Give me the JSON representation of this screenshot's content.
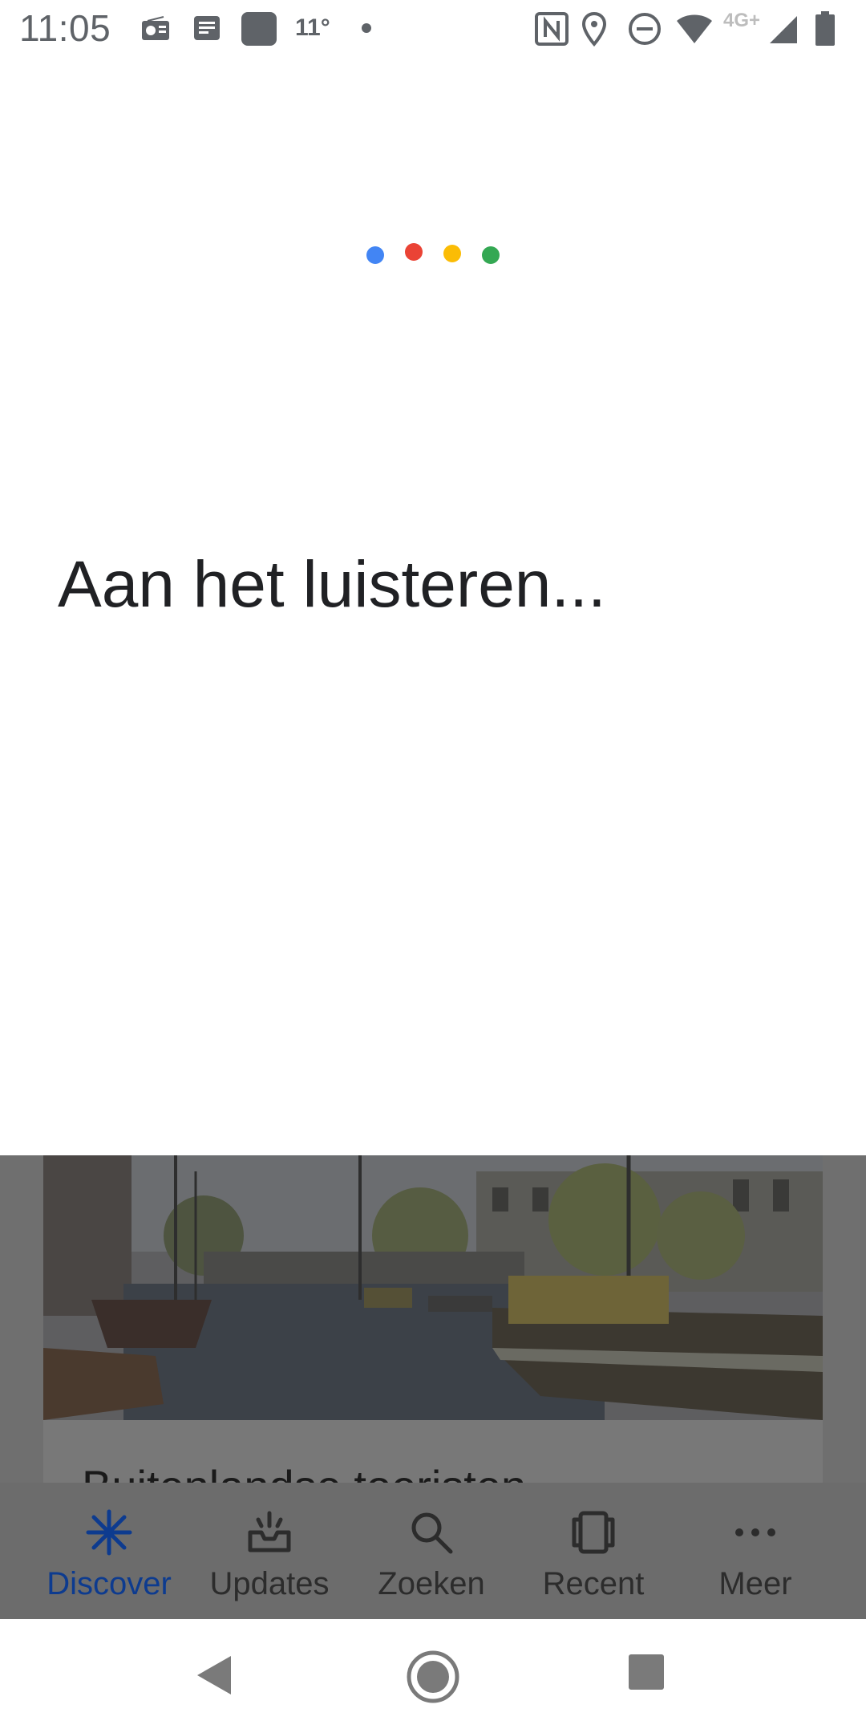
{
  "status_bar": {
    "time": "11:05",
    "temperature": "11°",
    "network": "4G+",
    "icons": [
      "radio-icon",
      "news-icon",
      "app-square-icon",
      "dot-icon",
      "nfc-icon",
      "location-icon",
      "do-not-disturb-icon",
      "wifi-icon",
      "signal-icon",
      "battery-icon"
    ]
  },
  "assistant": {
    "dots_colors": [
      "#4285F4",
      "#EA4335",
      "#FBBC05",
      "#34A853"
    ],
    "listening_text": "Aan het luisteren..."
  },
  "background_app": {
    "card_title": "Buitenlandse toeristen",
    "nav": {
      "items": [
        {
          "label": "Discover",
          "icon": "asterisk-icon",
          "active": true
        },
        {
          "label": "Updates",
          "icon": "inbox-icon",
          "active": false
        },
        {
          "label": "Zoeken",
          "icon": "search-icon",
          "active": false
        },
        {
          "label": "Recent",
          "icon": "recent-cards-icon",
          "active": false
        },
        {
          "label": "Meer",
          "icon": "more-horiz-icon",
          "active": false
        }
      ]
    }
  },
  "system_nav": {
    "buttons": [
      "back-icon",
      "home-icon",
      "overview-icon"
    ]
  },
  "colors": {
    "active_nav": "#0d3b8f",
    "overlay_dim": "#6f6f6f"
  }
}
